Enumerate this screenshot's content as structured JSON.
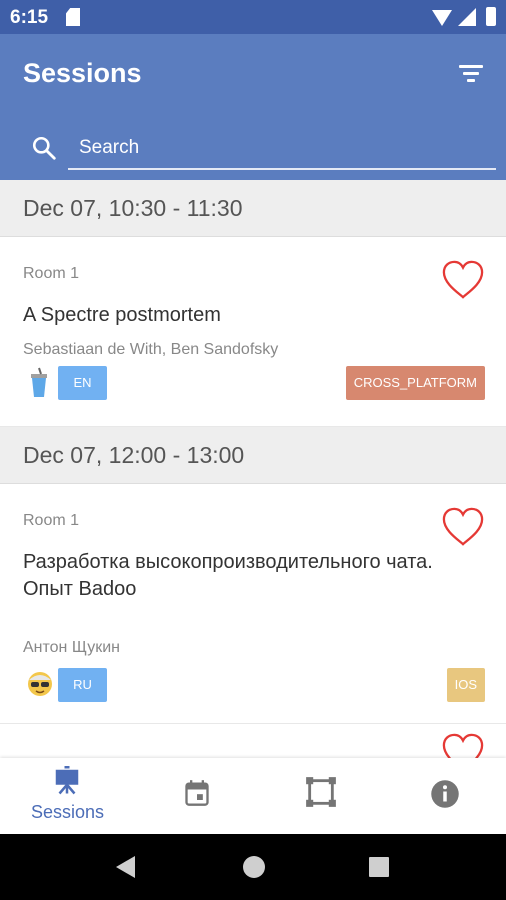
{
  "status_bar": {
    "time": "6:15"
  },
  "toolbar": {
    "title": "Sessions"
  },
  "search": {
    "placeholder": "Search"
  },
  "groups": [
    {
      "header": "Dec 07, 10:30 - 11:30",
      "session": {
        "room": "Room 1",
        "title": "A Spectre postmortem",
        "speakers": "Sebastiaan de With, Ben Sandofsky",
        "language": "EN",
        "tag": "CROSS_PLATFORM",
        "tag_color": "#d7886f"
      }
    },
    {
      "header": "Dec 07, 12:00 - 13:00",
      "session": {
        "room": "Room 1",
        "title": "Разработка высокопроизводительного чата. Опыт Badoo",
        "speakers": "Антон Щукин",
        "language": "RU",
        "tag": "IOS",
        "tag_color": "#e8c77f"
      }
    }
  ],
  "bottom_nav": {
    "items": [
      {
        "label": "Sessions",
        "icon": "easel-icon",
        "active": true
      },
      {
        "label": "",
        "icon": "calendar-icon",
        "active": false
      },
      {
        "label": "",
        "icon": "venue-icon",
        "active": false
      },
      {
        "label": "",
        "icon": "info-icon",
        "active": false
      }
    ]
  },
  "colors": {
    "status_bar": "#3f5fa8",
    "toolbar": "#5b7dbf",
    "favorite": "#e53935",
    "language_badge": "#71b1f2",
    "active_nav": "#4c6db7"
  }
}
